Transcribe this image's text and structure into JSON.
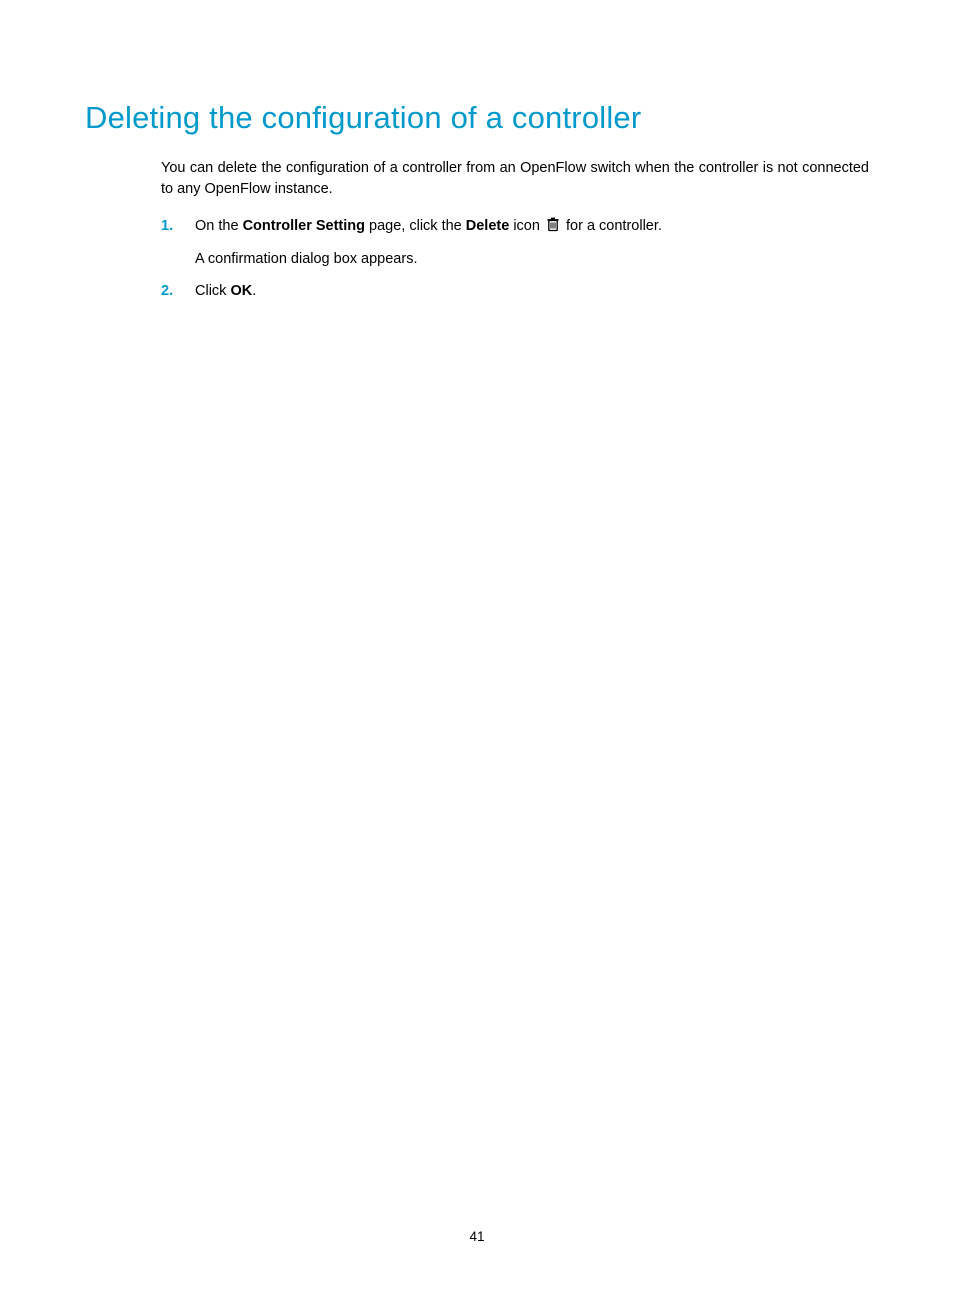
{
  "heading": "Deleting the configuration of a controller",
  "intro": "You can delete the configuration of a controller from an OpenFlow switch when the controller is not connected to any OpenFlow instance.",
  "steps": [
    {
      "num": "1.",
      "pre": "On the ",
      "bold1": "Controller Setting",
      "mid1": " page, click the ",
      "bold2": "Delete",
      "mid2": " icon ",
      "post": " for a controller.",
      "sub": "A confirmation dialog box appears."
    },
    {
      "num": "2.",
      "pre": "Click ",
      "bold1": "OK",
      "post": "."
    }
  ],
  "page_number": "41"
}
